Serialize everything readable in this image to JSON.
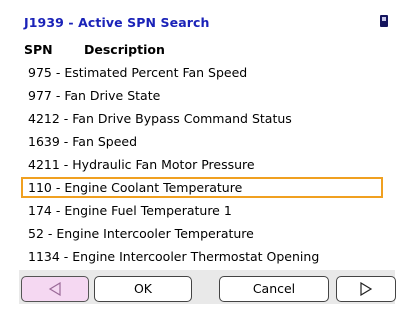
{
  "title": "J1939 - Active SPN Search",
  "icons": {
    "status": "device-icon"
  },
  "columns": {
    "spn": "SPN",
    "description": "Description"
  },
  "items": [
    "975 - Estimated Percent Fan Speed",
    "977 - Fan Drive State",
    "4212 - Fan Drive Bypass Command Status",
    "1639 - Fan Speed",
    "4211 - Hydraulic Fan Motor Pressure",
    "110 - Engine Coolant Temperature",
    "174 - Engine Fuel Temperature 1",
    "52 - Engine Intercooler Temperature",
    "1134 - Engine Intercooler Thermostat Opening"
  ],
  "selected_index": 5,
  "buttons": {
    "prev_icon": "triangle-left-icon",
    "ok": "OK",
    "cancel": "Cancel",
    "next_icon": "triangle-right-icon"
  },
  "colors": {
    "title": "#1a22b8",
    "selection_border": "#f0a020",
    "prev_button_bg": "#f5d8f2",
    "footer_bg": "#e9e9e9"
  }
}
